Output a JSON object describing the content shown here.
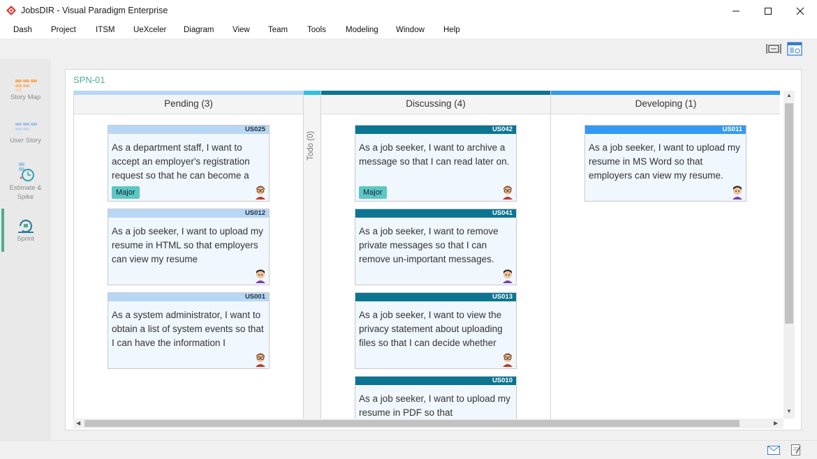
{
  "window": {
    "title": "JobsDIR - Visual Paradigm Enterprise",
    "logo_icon": "visual-paradigm-logo",
    "controls": [
      "minimize-icon",
      "maximize-icon",
      "close-icon"
    ]
  },
  "menu": [
    "Dash",
    "Project",
    "ITSM",
    "UeXceler",
    "Diagram",
    "View",
    "Team",
    "Tools",
    "Modeling",
    "Window",
    "Help"
  ],
  "toolbar": {
    "icons": [
      "fit-width-icon",
      "layout-icon"
    ]
  },
  "nav": {
    "items": [
      {
        "label": "Story Map",
        "icon": "story-map-icon"
      },
      {
        "label": "User Story",
        "icon": "user-story-icon"
      },
      {
        "label_line1": "Estimate &",
        "label_line2": "Spike",
        "icon": "estimate-spike-icon"
      },
      {
        "label": "Sprint",
        "icon": "sprint-icon",
        "active": true
      }
    ]
  },
  "sprint": {
    "title": "SPN-01"
  },
  "board": {
    "columns": [
      {
        "title": "Pending (3)",
        "bar_color": "#b8d7f5",
        "cards": [
          {
            "id": "US025",
            "text": "As a department staff, I want to accept an employer's registration request so that he can become a",
            "tag": "Major",
            "avatar": "male-glasses-avatar"
          },
          {
            "id": "US012",
            "text": "As a job seeker, I want to upload my resume in HTML so that employers can view my resume",
            "tag": "",
            "avatar": "male-avatar"
          },
          {
            "id": "US001",
            "text": "As a system administrator, I want to obtain a list of system events so that I can have the information I",
            "tag": "",
            "avatar": "male-glasses-avatar"
          }
        ]
      },
      {
        "title": "Todo (0)",
        "bar_color": "#2fc0e0"
      },
      {
        "title": "Discussing (4)",
        "bar_color": "#0b7592",
        "cards": [
          {
            "id": "US042",
            "text": "As a job seeker, I want to archive a message so that I can read later on.",
            "tag": "Major",
            "avatar": "male-glasses-avatar"
          },
          {
            "id": "US041",
            "text": "As a job seeker, I want to remove private messages so that I can remove un-important messages.",
            "tag": "",
            "avatar": "male-avatar"
          },
          {
            "id": "US013",
            "text": "As a job seeker, I want to view the privacy statement about uploading files so that I can decide whether",
            "tag": "",
            "avatar": "male-glasses-avatar"
          },
          {
            "id": "US010",
            "text": "As a job seeker, I want to upload my resume in PDF so that",
            "tag": "",
            "avatar": "male-avatar"
          }
        ]
      },
      {
        "title": "Developing (1)",
        "bar_color": "#3399f3",
        "cards": [
          {
            "id": "US011",
            "text": "As a job seeker, I want to upload my resume in MS Word so that employers can view my resume.",
            "tag": "",
            "avatar": "male-avatar"
          }
        ]
      }
    ]
  },
  "statusbar": {
    "icons": [
      "mail-icon",
      "notes-icon"
    ]
  }
}
